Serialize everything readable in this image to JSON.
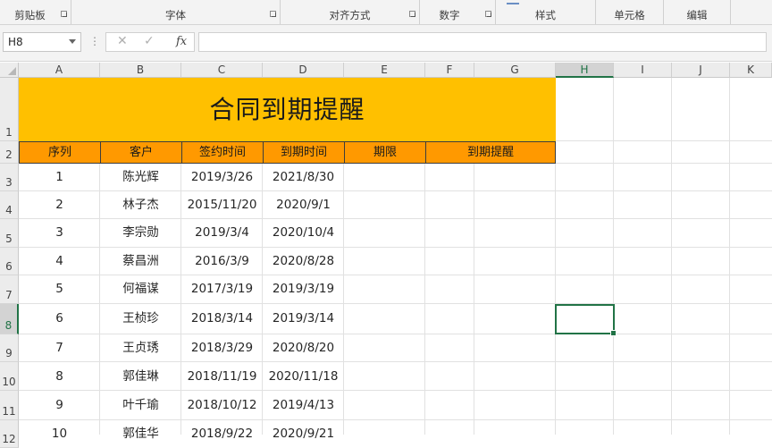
{
  "ribbon": {
    "groups": [
      "剪贴板",
      "字体",
      "对齐方式",
      "数字",
      "样式",
      "单元格",
      "编辑"
    ]
  },
  "formula_bar": {
    "name_box": "H8",
    "cancel_glyph": "✕",
    "enter_glyph": "✓",
    "fx_label": "fx",
    "formula": ""
  },
  "columns": [
    "A",
    "B",
    "C",
    "D",
    "E",
    "F",
    "G",
    "H",
    "I",
    "J",
    "K"
  ],
  "rows": [
    "1",
    "2",
    "3",
    "4",
    "5",
    "6",
    "7",
    "8",
    "9",
    "10",
    "11",
    "12"
  ],
  "active_cell": "H8",
  "sheet": {
    "title": "合同到期提醒",
    "headers": [
      "序列",
      "客户",
      "签约时间",
      "到期时间",
      "期限",
      "到期提醒"
    ],
    "data_rows": [
      [
        "1",
        "陈光辉",
        "2019/3/26",
        "2021/8/30"
      ],
      [
        "2",
        "林子杰",
        "2015/11/20",
        "2020/9/1"
      ],
      [
        "3",
        "李宗勋",
        "2019/3/4",
        "2020/10/4"
      ],
      [
        "4",
        "蔡昌洲",
        "2016/3/9",
        "2020/8/28"
      ],
      [
        "5",
        "何福谋",
        "2017/3/19",
        "2019/3/19"
      ],
      [
        "6",
        "王桢珍",
        "2018/3/14",
        "2019/3/14"
      ],
      [
        "7",
        "王贞琇",
        "2018/3/29",
        "2020/8/20"
      ],
      [
        "8",
        "郭佳琳",
        "2018/11/19",
        "2020/11/18"
      ],
      [
        "9",
        "叶千瑜",
        "2018/10/12",
        "2019/4/13"
      ],
      [
        "10",
        "郭佳华",
        "2018/9/22",
        "2020/9/21"
      ]
    ]
  },
  "colors": {
    "title_fill": "#ffc000",
    "header_fill": "#ff9900",
    "selection": "#217346"
  }
}
